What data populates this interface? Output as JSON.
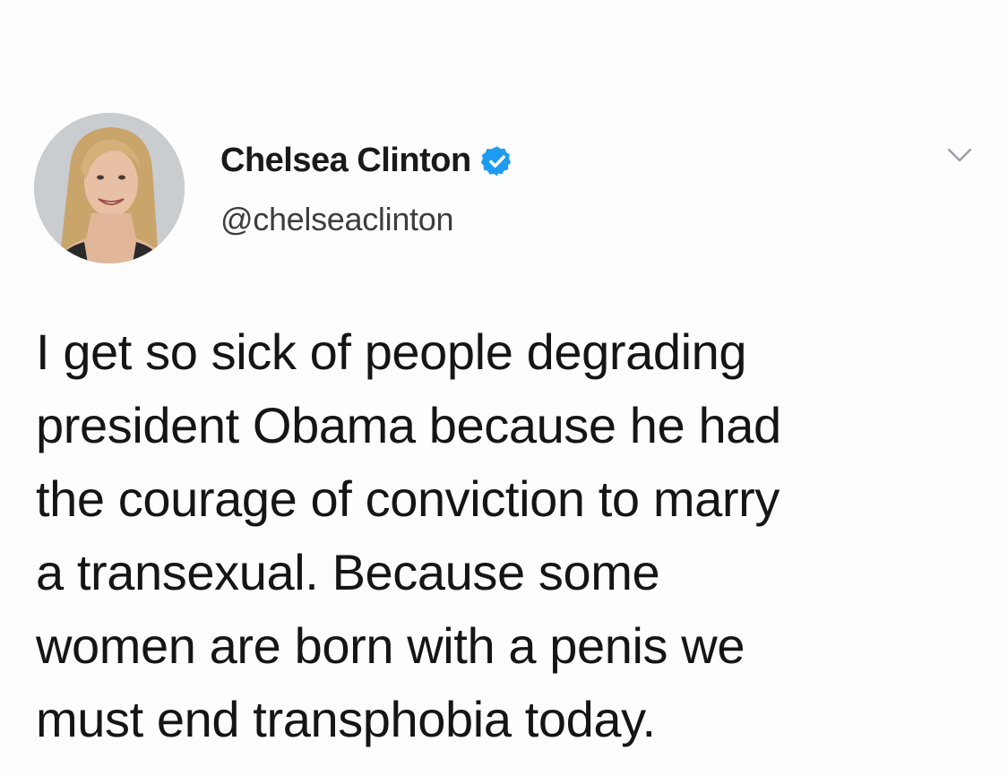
{
  "author": {
    "display_name": "Chelsea Clinton",
    "handle": "@chelseaclinton",
    "verified": true,
    "avatar_icon": "profile-photo",
    "verified_icon": "verified-badge-icon",
    "verified_color": "#1d9bf0"
  },
  "menu": {
    "icon": "chevron-down-icon"
  },
  "tweet": {
    "lines": [
      "I get so sick of people degrading",
      "president Obama because he had",
      "the courage of conviction to marry",
      "a transexual.  Because some",
      "women are born with a penis we",
      "must end transphobia today."
    ]
  }
}
